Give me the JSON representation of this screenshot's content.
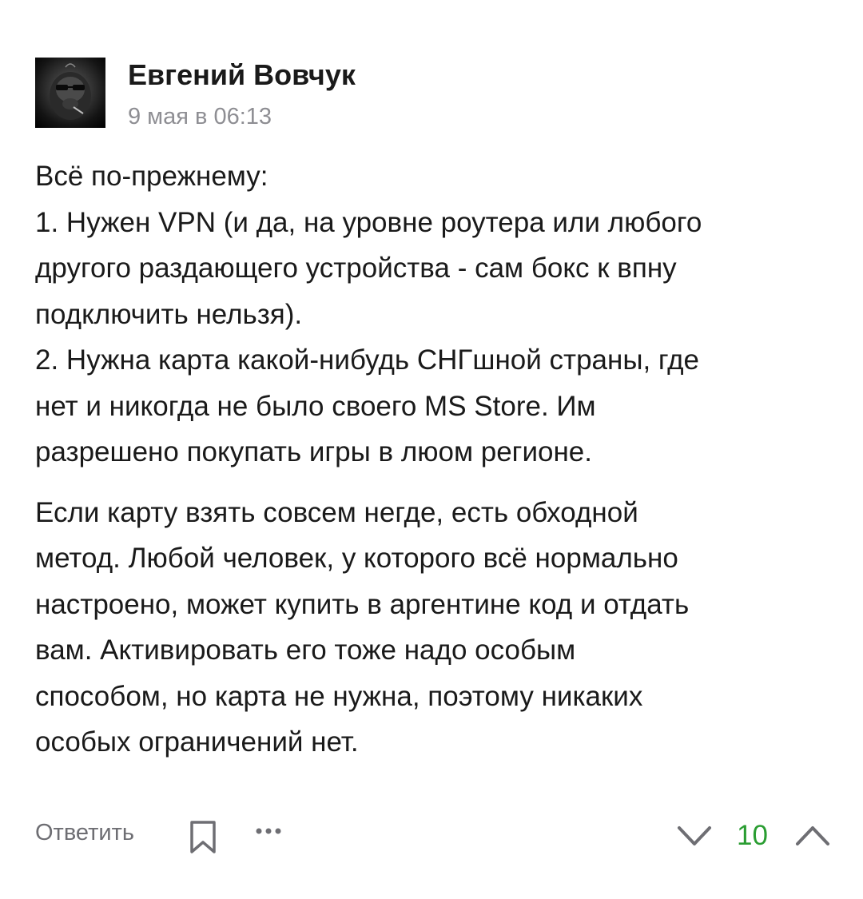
{
  "comment": {
    "author": "Евгений Вовчук",
    "date": "9 мая в 06:13",
    "paragraphs": [
      {
        "lines": [
          "Всё по-прежнему:",
          "1. Нужен VPN (и да, на уровне роутера или любого",
          "другого раздающего устройства - сам бокс к впну",
          "подключить нельзя).",
          "2. Нужна карта какой-нибудь СНГшной страны, где",
          "нет и никогда не было своего MS Store. Им",
          "разрешено покупать игры в люом регионе."
        ]
      },
      {
        "lines": [
          "Если карту взять совсем негде, есть обходной",
          "метод. Любой человек, у которого всё нормально",
          "настроено, может купить в аргентине код и отдать",
          "вам. Активировать его тоже надо особым",
          "способом, но карта не нужна, поэтому никаких",
          "особых ограничений нет."
        ]
      }
    ],
    "actions": {
      "reply_label": "Ответить",
      "bookmark_icon": "bookmark-icon",
      "more_icon": "more-icon"
    },
    "rating": {
      "score": "10",
      "score_color": "#2a9d32",
      "down_icon": "chevron-down-icon",
      "up_icon": "chevron-up-icon"
    }
  }
}
